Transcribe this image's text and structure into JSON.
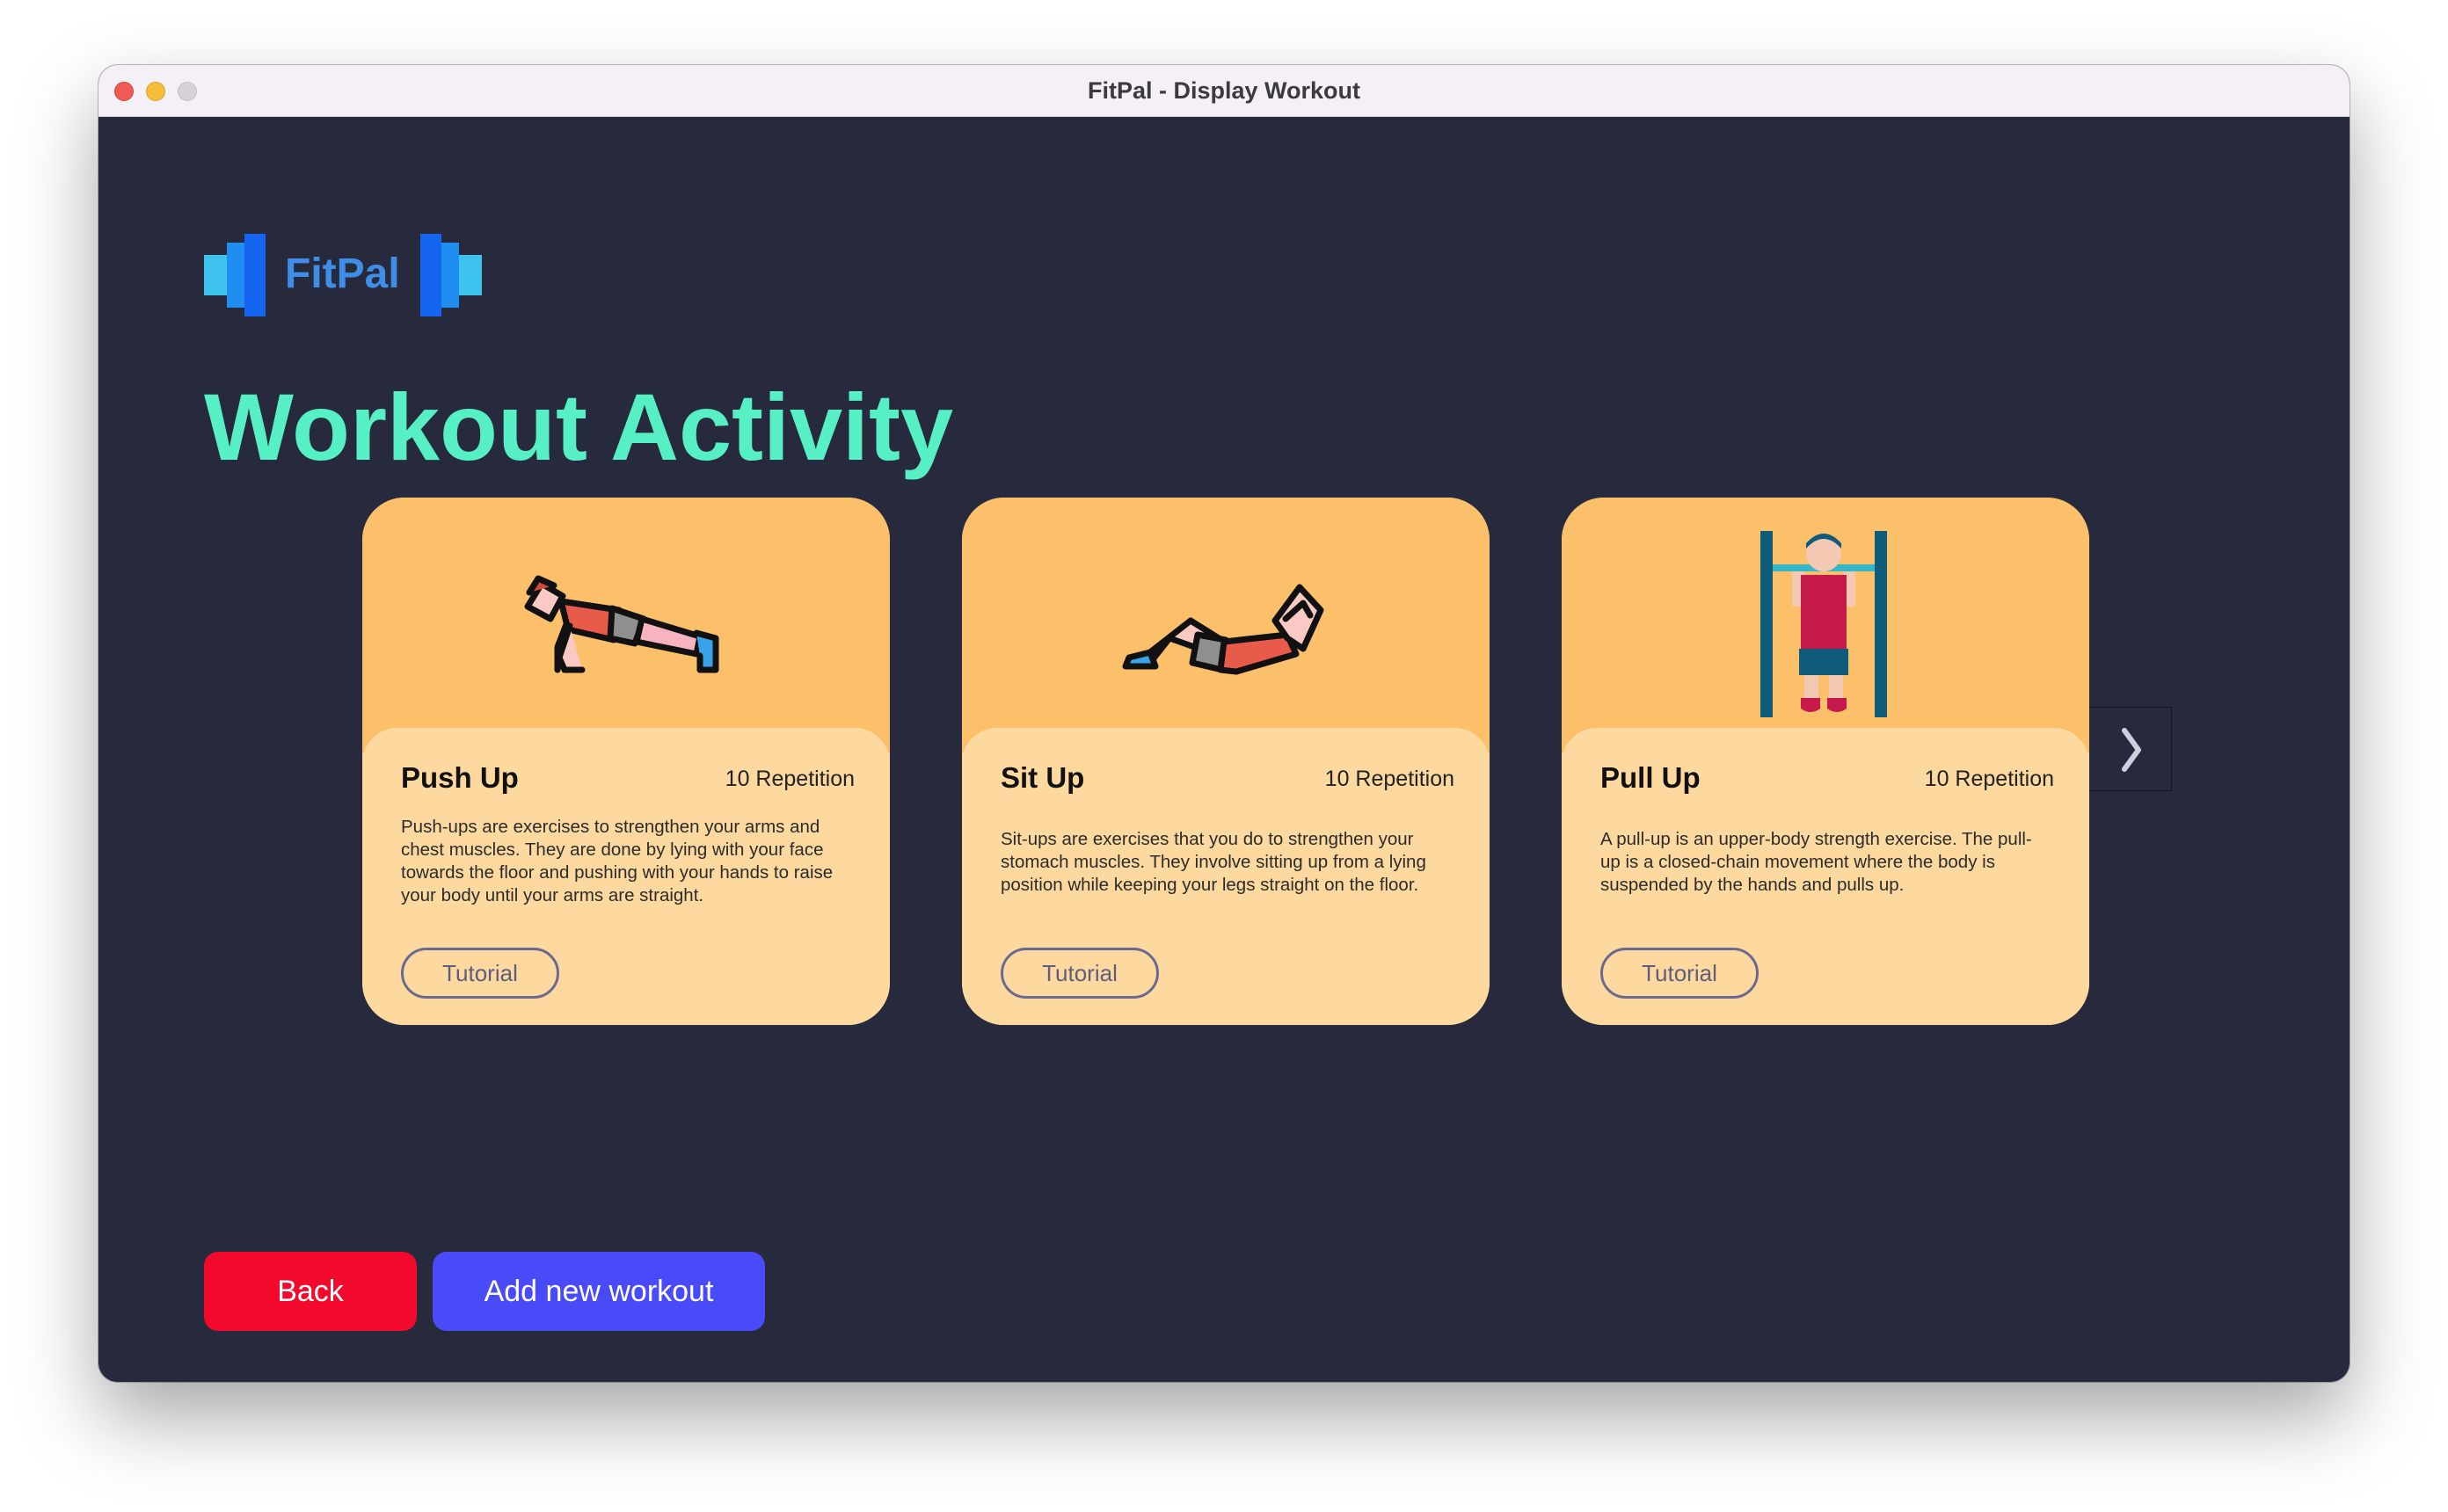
{
  "window": {
    "title": "FitPal - Display Workout"
  },
  "logo": {
    "text": "FitPal"
  },
  "page": {
    "heading": "Workout Activity"
  },
  "cards": [
    {
      "name": "Push Up",
      "reps": "10 Repetition",
      "description": "Push-ups are exercises to strengthen your arms and chest muscles. They are done by lying with your face towards the floor and pushing with your hands to raise your body until your arms are straight.",
      "tutorial_label": "Tutorial",
      "illustration": "push-up-illustration"
    },
    {
      "name": "Sit Up",
      "reps": "10 Repetition",
      "description": "Sit-ups are exercises that you do to strengthen your stomach muscles. They involve sitting up from a lying position while keeping your legs straight on the floor.",
      "tutorial_label": "Tutorial",
      "illustration": "sit-up-illustration"
    },
    {
      "name": "Pull Up",
      "reps": "10 Repetition",
      "description": "A pull-up is an upper-body strength exercise. The pull-up is a closed-chain movement where the body is suspended by the hands and pulls up.",
      "tutorial_label": "Tutorial",
      "illustration": "pull-up-illustration"
    }
  ],
  "carousel": {
    "next_icon": "chevron-right-icon"
  },
  "actions": {
    "back_label": "Back",
    "add_label": "Add new workout"
  },
  "colors": {
    "background": "#272a3d",
    "heading": "#56f0c4",
    "card_top": "#fcc06a",
    "card_body": "#fdd99f",
    "back_button": "#f2092c",
    "add_button": "#4a4bf8"
  }
}
